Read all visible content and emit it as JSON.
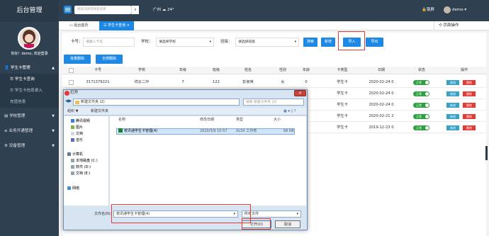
{
  "app": {
    "title": "后台管理",
    "greeting": "你好！demo, 欢迎登录"
  },
  "topbar": {
    "search_placeholder": "搜索选择或搜索选择",
    "city": "广州",
    "temp": "24°",
    "lock": "锁屏",
    "user": "demo"
  },
  "sidebar": {
    "items": [
      {
        "label": "学生卡管理",
        "caret": "▲"
      },
      {
        "label": "学生卡查询"
      },
      {
        "label": "学生卡信息录入"
      },
      {
        "label": "充值信息"
      },
      {
        "label": "学校管理",
        "caret": "▼"
      },
      {
        "label": "业务开通管理",
        "caret": "▼"
      },
      {
        "label": "设备管理",
        "caret": "▼"
      }
    ]
  },
  "tabs": {
    "home": "后台首页",
    "query": "学生卡查询",
    "close": "×",
    "page_ops": "页面操作"
  },
  "filters": {
    "card_label": "卡号：",
    "card_placeholder": "请输入卡号",
    "school_label": "学校：",
    "school_value": "请选择学校",
    "class_label": "班级：",
    "class_value": "请选择班级"
  },
  "buttons": {
    "search": "搜索",
    "add": "新增",
    "import": "导入",
    "export": "导出",
    "batch_delete": "批量删除",
    "delete_all": "全部删除"
  },
  "table": {
    "headers": [
      "卡号",
      "学校",
      "年级",
      "班级",
      "姓名",
      "性别",
      "年龄",
      "卡类型",
      "日期",
      "状态",
      "操作"
    ],
    "rows": [
      [
        "3171379221",
        "祥云二中",
        "7",
        "122",
        "彭家英",
        "女",
        "0",
        "学生卡",
        "2020-02-24 0"
      ],
      [
        "",
        "",
        "",
        "",
        "",
        "",
        "",
        "学生卡",
        "2020-02-24 0"
      ],
      [
        "",
        "",
        "",
        "",
        "",
        "",
        "",
        "学生卡",
        "2020-02-24 0"
      ],
      [
        "",
        "",
        "",
        "",
        "",
        "",
        "",
        "学生卡",
        "2020-02-21 2"
      ],
      [
        "",
        "",
        "",
        "",
        "",
        "",
        "",
        "学生卡",
        "2019-12-23 0"
      ]
    ],
    "status_label": "正常",
    "edit_label": "修改",
    "delete_label": "删除"
  },
  "dialog": {
    "title": "打开",
    "path": "新建文件夹 (2)",
    "search_placeholder": "搜索 新建文件夹 (2)",
    "organize": "组织 ▼",
    "new_folder": "新建文件夹",
    "nav": [
      "腾讯视频",
      "图片",
      "文档",
      "音乐",
      "计算机",
      "本地磁盘 (C:)",
      "软件 (D:)",
      "文档 (E:)",
      "网络"
    ],
    "columns": {
      "name": "名称",
      "modified": "修改日期",
      "type": "类型",
      "size": "大小"
    },
    "file": {
      "name": "校讯通学生卡管理(4)",
      "modified": "2020/3/9 10:57",
      "type": "XLSX 工作表",
      "size": "68 KB"
    },
    "filename_label": "文件名(N):",
    "filename_value": "校讯通学生卡管理(4)",
    "filetype": "所有文件",
    "open": "打开(O)",
    "cancel": "取消"
  },
  "colors": {
    "sidebar": "#2f4050",
    "primary": "#1e88e5",
    "highlight": "#e53935",
    "toggle": "#2e9f3e"
  }
}
